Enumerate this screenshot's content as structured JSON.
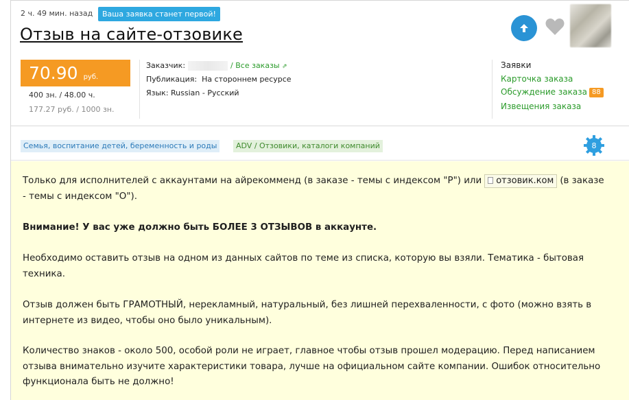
{
  "meta": {
    "time_ago": "2 ч. 49 мин. назад",
    "first_badge": "Ваша заявка станет первой!",
    "title": "Отзыв на сайте-отзовике"
  },
  "actions": {
    "up_icon": "arrow-up-icon",
    "favorite_icon": "heart-icon"
  },
  "price": {
    "value": "70.90",
    "currency": "руб.",
    "chars_line": "400 зн. / 48.00 ч.",
    "rate_line": "177.27 руб. / 1000 зн."
  },
  "info": {
    "customer_label": "Заказчик:",
    "all_orders": "/ Все заказы",
    "publication_label": "Публикация:",
    "publication_value": "На стороннем ресурсе",
    "language_label": "Язык:",
    "language_value": "Russian - Русский"
  },
  "side": {
    "bids": "Заявки",
    "card": "Карточка заказа",
    "discussion": "Обсуждение заказа",
    "discussion_count": "88",
    "notices": "Извещения заказа"
  },
  "tags": [
    {
      "label": "Семья, воспитание детей, беременность и роды"
    },
    {
      "label": "ADV / Отзовики, каталоги компаний"
    }
  ],
  "gear_badge": "8",
  "description": {
    "p1_before": "Только для исполнителей с аккаунтами на айрекомменд (в заказе - темы с индексом \"Р\") или",
    "p1_site": "отзовик.ком",
    "p1_after": "(в заказе - темы с индексом \"О\").",
    "p2": "Внимание! У вас уже должно быть БОЛЕЕ 3 ОТЗЫВОВ в аккаунте.",
    "p3": "Необходимо оставить отзыв на одном из данных сайтов по теме из списка, которую вы взяли. Тематика - бытовая техника.",
    "p4": "Отзыв должен быть ГРАМОТНЫЙ, нерекламный, натуральный, без лишней перехваленности, с фото (можно взять в интернете из видео, чтобы оно было уникальным).",
    "p5": "Количество знаков - около 500, особой роли не играет, главное чтобы отзыв прошел модерацию. Перед написанием отзыва внимательно изучите характеристики товара, лучше на официальном сайте компании. Ошибок относительно функционала быть не должно!"
  },
  "colors": {
    "accent_blue": "#2a93d5",
    "price_orange": "#f59a23",
    "link_green": "#2b9b2b",
    "body_bg": "#ffffdd"
  }
}
